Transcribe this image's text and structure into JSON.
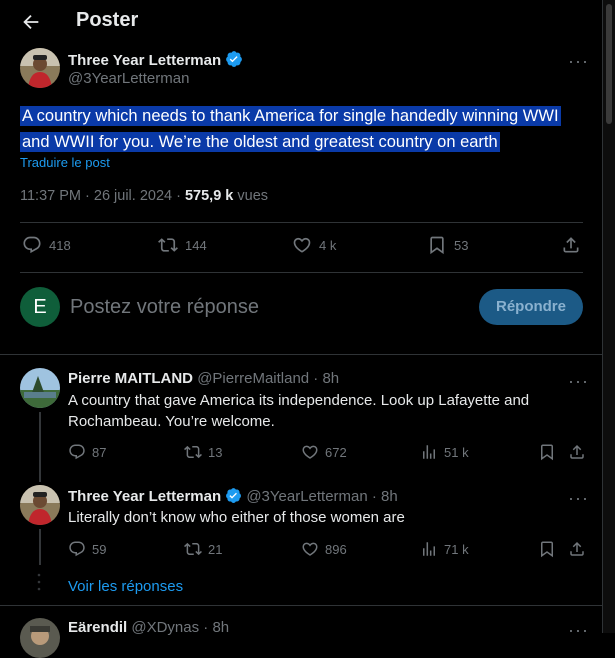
{
  "header": {
    "title": "Poster"
  },
  "main_post": {
    "author_name": "Three Year Letterman",
    "author_handle": "@3YearLetterman",
    "text": "A country which needs to thank America for single handedly winning WWI and WWII for you. We’re the oldest and greatest country on earth",
    "translate_label": "Traduire le post",
    "time": "11:37 PM · 26 juil. 2024 · ",
    "views_count": "575,9 k",
    "views_label": " vues",
    "replies": "418",
    "reposts": "144",
    "likes": "4 k",
    "bookmarks": "53"
  },
  "reply_box": {
    "avatar_letter": "E",
    "placeholder": "Postez votre réponse",
    "button_label": "Répondre"
  },
  "comments": [
    {
      "name": "Pierre MAITLAND",
      "handle": "@PierreMaitland · 8h",
      "text": "A country that gave America its independence. Look up Lafayette and Rochambeau. You’re welcome.",
      "replies": "87",
      "reposts": "13",
      "likes": "672",
      "views": "51 k"
    },
    {
      "name": "Three Year Letterman",
      "handle": "@3YearLetterman · 8h",
      "text": "Literally don’t know who either of those women are",
      "replies": "59",
      "reposts": "21",
      "likes": "896",
      "views": "71 k"
    },
    {
      "name": "Eärendil",
      "handle": "@XDynas · 8h"
    }
  ],
  "see_replies_label": "Voir les réponses",
  "colors": {
    "accent": "#1d9bf0",
    "highlight": "#0a3aa8",
    "button": "#1c5a86"
  }
}
